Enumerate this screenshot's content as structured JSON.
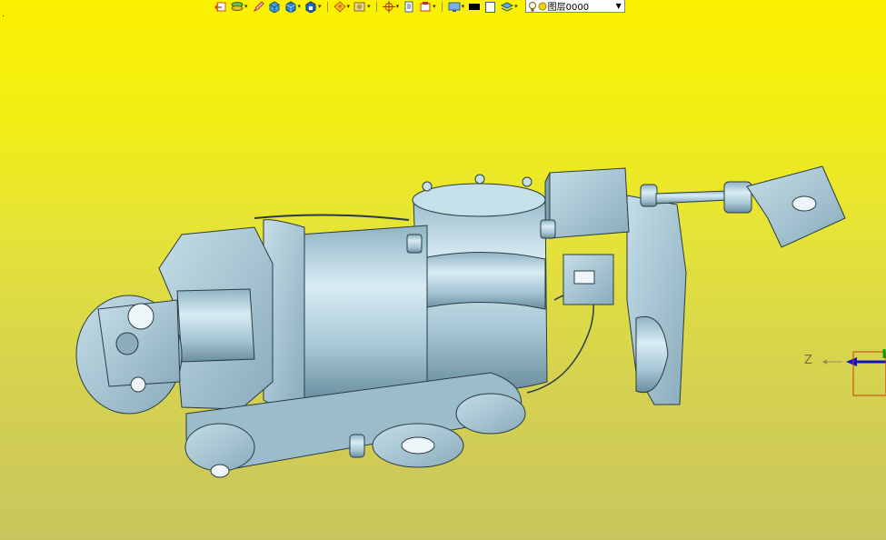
{
  "toolbar": {
    "buttons": [
      {
        "name": "exit-icon",
        "color": "#d04a1a"
      },
      {
        "name": "layers-icon",
        "color": "#2a9a3a"
      },
      {
        "name": "pen-icon",
        "color": "#c03030"
      },
      {
        "name": "cube-icon",
        "color": "#2d7fd0"
      },
      {
        "name": "cube-blue-icon",
        "color": "#1f6ac0"
      },
      {
        "name": "solid-icon",
        "color": "#1f6ac0"
      },
      {
        "name": "wireframe-icon",
        "color": "#d05a20"
      },
      {
        "name": "render-icon",
        "color": "#c0a040"
      },
      {
        "name": "crosshair-icon",
        "color": "#c02020"
      },
      {
        "name": "page-icon",
        "color": "#406090"
      },
      {
        "name": "frame-icon",
        "color": "#c03030"
      },
      {
        "name": "screen-icon",
        "color": "#3060a0"
      },
      {
        "name": "color-black-icon",
        "color": "#000000"
      },
      {
        "name": "color-white-icon",
        "color": "#ffffff"
      },
      {
        "name": "layer-stack-icon",
        "color": "#2a7ac0"
      }
    ],
    "layer_select": {
      "value": "图层0000"
    }
  },
  "axis": {
    "z_label": "Z"
  },
  "colors": {
    "model_fill": "#a9c9d6",
    "model_edge": "#2a3c44",
    "bg_top": "#fbf100",
    "bg_bottom": "#c9c55c"
  }
}
